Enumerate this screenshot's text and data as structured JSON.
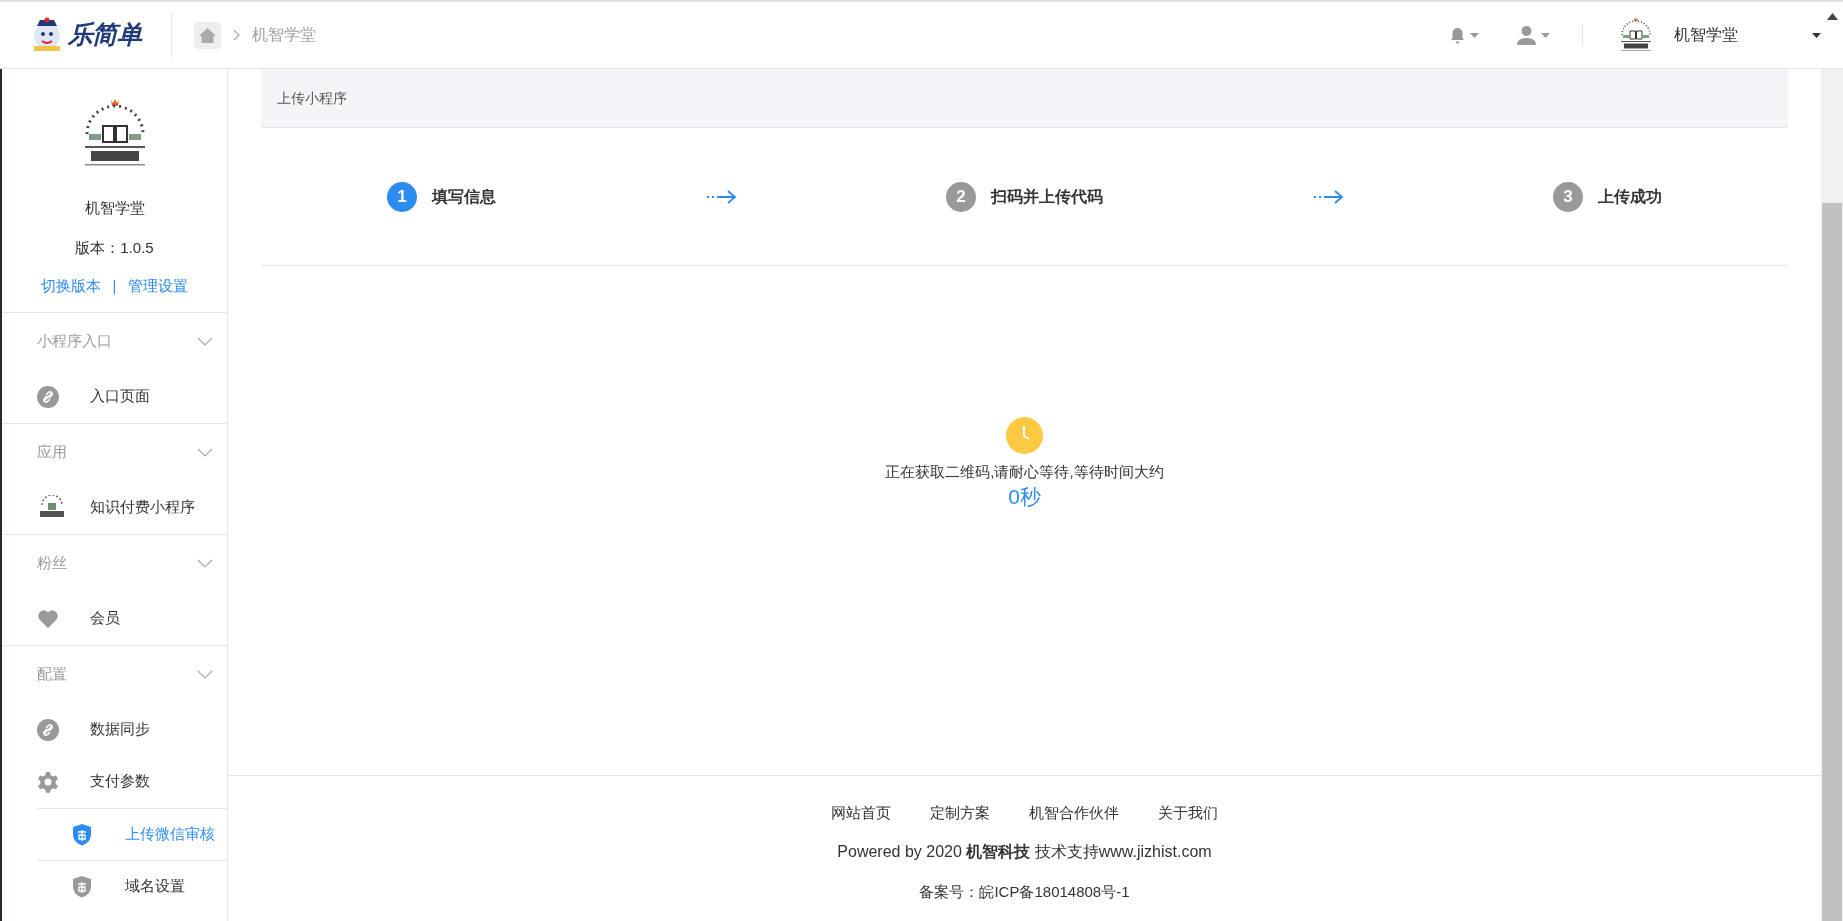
{
  "header": {
    "brand": "乐简单",
    "breadcrumb": "机智学堂",
    "account_name": "机智学堂"
  },
  "sidebar": {
    "account_name": "机智学堂",
    "version": "版本：1.0.5",
    "links": [
      "切换版本",
      "管理设置"
    ],
    "separator": "|",
    "groups": [
      {
        "title": "小程序入口",
        "items": [
          {
            "label": "入口页面",
            "kind": "link",
            "selected": false
          }
        ]
      },
      {
        "title": "应用",
        "items": [
          {
            "label": "知识付费小程序",
            "kind": "app",
            "selected": false
          }
        ]
      },
      {
        "title": "粉丝",
        "items": [
          {
            "label": "会员",
            "kind": "heart",
            "selected": false
          }
        ]
      },
      {
        "title": "配置",
        "items": [
          {
            "label": "数据同步",
            "kind": "link",
            "selected": false
          },
          {
            "label": "支付参数",
            "kind": "gear",
            "selected": false
          },
          {
            "label": "上传微信审核",
            "kind": "shield",
            "selected": true
          },
          {
            "label": "域名设置",
            "kind": "shield",
            "selected": false
          }
        ]
      }
    ]
  },
  "panel": {
    "title": "上传小程序",
    "steps": [
      {
        "number": "1",
        "label": "填写信息",
        "active": true
      },
      {
        "number": "2",
        "label": "扫码并上传代码",
        "active": false
      },
      {
        "number": "3",
        "label": "上传成功",
        "active": false
      }
    ],
    "waiting_message": "正在获取二维码,请耐心等待,等待时间大约",
    "countdown": "0秒"
  },
  "footer": {
    "links": [
      "网站首页",
      "定制方案",
      "机智合作伙伴",
      "关于我们"
    ],
    "powered": "Powered by 2020 **机智科技** 技术支持www.jizhist.com",
    "record": "备案号：皖ICP备18014808号-1"
  }
}
